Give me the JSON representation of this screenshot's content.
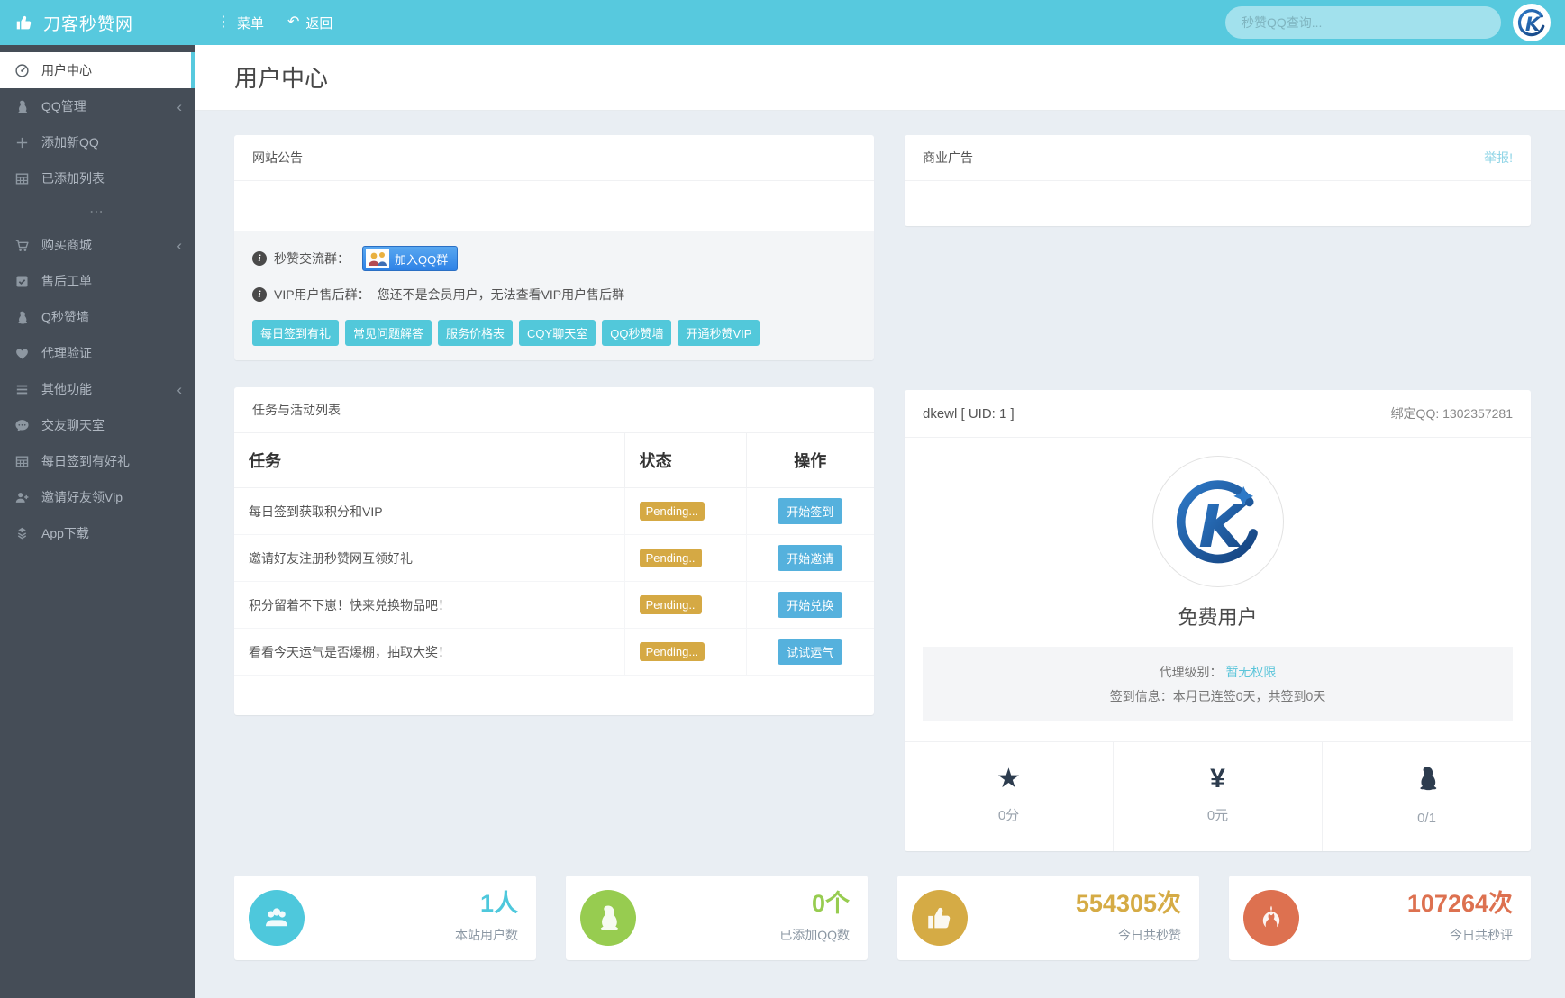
{
  "glyphs": {
    "menu_dots": "⋮",
    "back_arrow": "↶",
    "chevron": "‹",
    "separator": "⋯",
    "info": "i",
    "star": "★",
    "yen": "¥"
  },
  "header": {
    "brand": "刀客秒赞网",
    "menu": "菜单",
    "back": "返回",
    "search_placeholder": "秒赞QQ查询...",
    "bar_color": "#57c9de"
  },
  "sidebar": {
    "items": [
      {
        "label": "用户中心",
        "icon": "dashboard-icon",
        "active": true
      },
      {
        "label": "QQ管理",
        "icon": "penguin-icon",
        "chevron": true
      },
      {
        "label": "添加新QQ",
        "icon": "plus-icon"
      },
      {
        "label": "已添加列表",
        "icon": "table-icon"
      },
      {
        "label": "购买商城",
        "icon": "cart-icon",
        "chevron": true
      },
      {
        "label": "售后工单",
        "icon": "check-square-icon"
      },
      {
        "label": "Q秒赞墙",
        "icon": "penguin-icon"
      },
      {
        "label": "代理验证",
        "icon": "heart-icon"
      },
      {
        "label": "其他功能",
        "icon": "list-icon",
        "chevron": true
      },
      {
        "label": "交友聊天室",
        "icon": "comment-icon"
      },
      {
        "label": "每日签到有好礼",
        "icon": "table-icon"
      },
      {
        "label": "邀请好友领Vip",
        "icon": "user-plus-icon"
      },
      {
        "label": "App下载",
        "icon": "app-box-icon"
      }
    ]
  },
  "page": {
    "title": "用户中心"
  },
  "announcement": {
    "title": "网站公告",
    "group_label": "秒赞交流群：",
    "join_button": "加入QQ群",
    "vip_label": "VIP用户售后群：",
    "vip_text": "您还不是会员用户，无法查看VIP用户售后群",
    "quick_links": [
      "每日签到有礼",
      "常见问题解答",
      "服务价格表",
      "CQY聊天室",
      "QQ秒赞墙",
      "开通秒赞VIP"
    ]
  },
  "ad": {
    "title": "商业广告",
    "report": "举报!"
  },
  "tasks": {
    "title": "任务与活动列表",
    "columns": [
      "任务",
      "状态",
      "操作"
    ],
    "rows": [
      {
        "task": "每日签到获取积分和VIP",
        "status": "Pending...",
        "action": "开始签到"
      },
      {
        "task": "邀请好友注册秒赞网互领好礼",
        "status": "Pending..",
        "action": "开始邀请"
      },
      {
        "task": "积分留着不下崽！快来兑换物品吧！",
        "status": "Pending..",
        "action": "开始兑换"
      },
      {
        "task": "看看今天运气是否爆棚，抽取大奖！",
        "status": "Pending...",
        "action": "试试运气"
      }
    ],
    "status_color": "#d5a944",
    "action_color": "#55b1dd"
  },
  "profile": {
    "username": "dkewl [ UID: 1 ]",
    "bind_qq_label": "绑定QQ:",
    "bind_qq": "1302357281",
    "level": "免费用户",
    "agent_label": "代理级别：",
    "agent_value": "暂无权限",
    "signin_label": "签到信息：",
    "signin_value": "本月已连签0天，共签到0天",
    "stats": [
      {
        "icon": "star-icon",
        "value": "0分"
      },
      {
        "icon": "yen-icon",
        "value": "0元"
      },
      {
        "icon": "penguin-icon",
        "value": "0/1"
      }
    ]
  },
  "summary_cards": [
    {
      "icon": "users-icon",
      "value": "1人",
      "label": "本站用户数",
      "color": "#4ec8dc"
    },
    {
      "icon": "penguin-icon",
      "value": "0个",
      "label": "已添加QQ数",
      "color": "#97cc50"
    },
    {
      "icon": "thumbs-up-icon",
      "value": "554305次",
      "label": "今日共秒赞",
      "color": "#d5ab45"
    },
    {
      "icon": "rebel-icon",
      "value": "107264次",
      "label": "今日共秒评",
      "color": "#dd7150"
    }
  ]
}
